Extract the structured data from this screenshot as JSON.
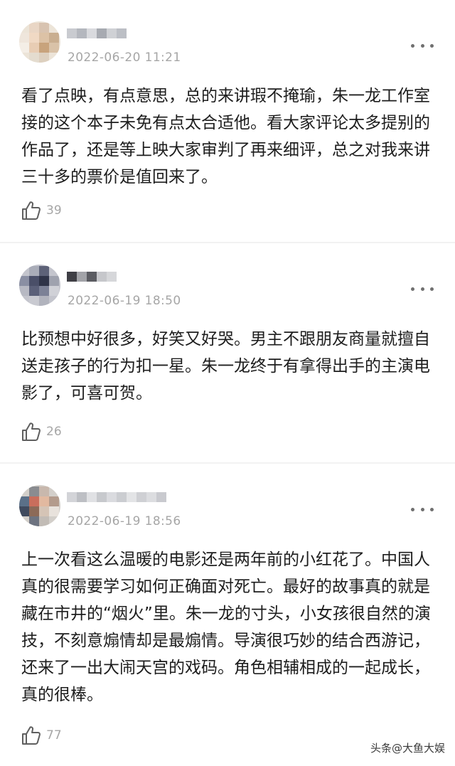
{
  "reviews": [
    {
      "date": "2022-06-20 11:21",
      "text": "看了点映，有点意思，总的来讲瑕不掩瑜，朱一龙工作室接的这个本子未免有点太合适他。看大家评论太多提别的作品了，还是等上映大家审判了再来细评，总之对我来讲三十多的票价是值回来了。",
      "likes": "39"
    },
    {
      "date": "2022-06-19 18:50",
      "text": "比预想中好很多，好笑又好哭。男主不跟朋友商量就擅自送走孩子的行为扣一星。朱一龙终于有拿得出手的主演电影了，可喜可贺。",
      "likes": "26"
    },
    {
      "date": "2022-06-19 18:56",
      "text": "上一次看这么温暖的电影还是两年前的小红花了。中国人真的很需要学习如何正确面对死亡。最好的故事真的就是藏在市井的“烟火”里。朱一龙的寸头，小女孩很自然的演技，不刻意煽情却是最煽情。导演很巧妙的结合西游记，还来了一出大闹天宫的戏码。角色相辅相成的一起成长，真的很棒。",
      "likes": "77"
    }
  ],
  "icons": {
    "more": "more-dots-icon",
    "like": "thumbs-up-icon"
  },
  "watermark": "头条@大鱼大娱",
  "colors": {
    "text": "#1d1d1d",
    "meta": "#a6a6a6",
    "background": "#ffffff",
    "divider": "#f2f2f2"
  }
}
